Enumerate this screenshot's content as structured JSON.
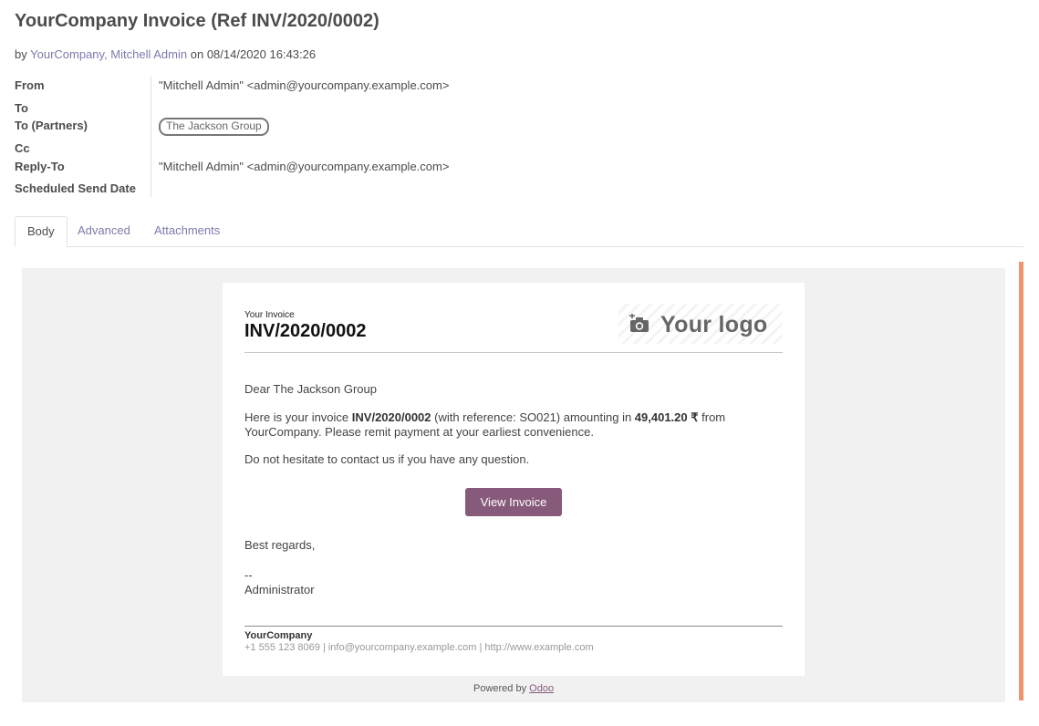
{
  "header": {
    "title": "YourCompany Invoice (Ref INV/2020/0002)",
    "by_prefix": "by",
    "author": "YourCompany, Mitchell Admin",
    "on_prefix": "on",
    "datetime": "08/14/2020 16:43:26"
  },
  "fields": {
    "from_label": "From",
    "from_value": "\"Mitchell Admin\" <admin@yourcompany.example.com>",
    "to_label": "To",
    "to_partners_label": "To (Partners)",
    "to_partners_tag": "The Jackson Group",
    "cc_label": "Cc",
    "reply_to_label": "Reply-To",
    "reply_to_value": "\"Mitchell Admin\" <admin@yourcompany.example.com>",
    "scheduled_label": "Scheduled Send Date"
  },
  "tabs": [
    {
      "label": "Body",
      "active": true
    },
    {
      "label": "Advanced",
      "active": false
    },
    {
      "label": "Attachments",
      "active": false
    }
  ],
  "email": {
    "eyebrow": "Your Invoice",
    "invoice_number": "INV/2020/0002",
    "logo_text": "Your logo",
    "greeting": "Dear The Jackson Group",
    "body_p1_a": "Here is your invoice ",
    "body_p1_invoice": "INV/2020/0002",
    "body_p1_b": " (with reference: SO021) amounting in ",
    "body_p1_amount": "49,401.20 ₹",
    "body_p1_c": " from YourCompany. Please remit payment at your earliest convenience.",
    "body_p2": "Do not hesitate to contact us if you have any question.",
    "button_label": "View Invoice",
    "regards": "Best regards,",
    "sig_dash": "--",
    "sig_name": "Administrator",
    "footer_company": "YourCompany",
    "footer_contact": "+1 555 123 8069 | info@yourcompany.example.com | http://www.example.com",
    "powered_prefix": "Powered by",
    "powered_link": "Odoo"
  },
  "colors": {
    "accent": "#875a7b",
    "link": "#7c7bad",
    "scroll_indicator": "#f0956b"
  },
  "icons": {
    "logo": "camera-plus-icon"
  }
}
